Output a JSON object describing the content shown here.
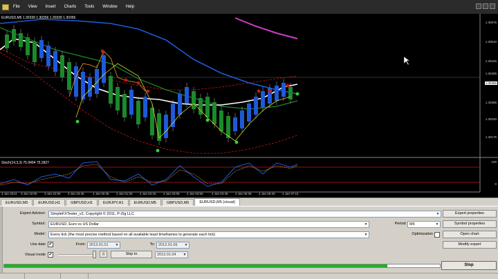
{
  "menu": {
    "items": [
      "File",
      "View",
      "Insert",
      "Charts",
      "Tools",
      "Window",
      "Help"
    ]
  },
  "chart": {
    "symbol_label": "EURUSD,M5 1.30339 1.30356 1.30339 1.30356",
    "osc_label": "Stoch(14,3,3) 75.9494 75.2827",
    "price_ticks": [
      "1.30575",
      "1.30510",
      "1.30445",
      "1.30405",
      "1.30356",
      "1.30285",
      "1.30220",
      "1.30175"
    ],
    "current_price": "1.30356",
    "osc_ticks": [
      "100",
      "0"
    ],
    "time_ticks": [
      "3 Jan 2013",
      "3 Jan 22:05",
      "3 Jan 22:55",
      "3 Jan 23:45",
      "4 Jan 00:35",
      "4 Jan 01:25",
      "4 Jan 02:15",
      "4 Jan 03:05",
      "4 Jan 03:55",
      "4 Jan 04:45",
      "4 Jan 05:35",
      "4 Jan 06:25",
      "4 Jan 07:15"
    ],
    "colors": {
      "green": "#1a8a2a",
      "blue": "#1e5ad8",
      "white": "#ffffff",
      "magenta": "#cc3dc6",
      "red": "#c41818",
      "orange": "#f0a020",
      "yellow": "#d7d73a"
    }
  },
  "tabs": {
    "items": [
      "EURUSD,M5",
      "EURUSD,H1",
      "GBPUSD,H1",
      "EURJPY,H1",
      "EURUSD,M5",
      "GBPUSD,M5",
      "EURUSD,M5 (visual)"
    ],
    "active_index": 6
  },
  "tester": {
    "expert_label": "Expert Advisor:",
    "expert_value": "SimpleFXTester_v2, Copyright © 2011, P-Zig LLC",
    "symbol_label": "Symbol:",
    "symbol_value": "EURUSD, Euro vs US Dollar",
    "period_label": "Period:",
    "period_value": "M5",
    "model_label": "Model:",
    "model_value": "Every tick (the most precise method based on all available least timeframes to generate each tick)",
    "optimization_label": "Optimization",
    "use_date_label": "Use date",
    "from_label": "From:",
    "from_value": "2013.01.01",
    "to_label": "To:",
    "to_value": "2013.01.06",
    "visual_mode_label": "Visual mode",
    "skip_to_label": "Skip to",
    "skip_to_value": "2013.01.04",
    "progress": 0.88,
    "buttons": {
      "expert_properties": "Expert properties",
      "symbol_properties": "Symbol properties",
      "open_chart": "Open chart",
      "modify_expert": "Modify expert",
      "stop": "Stop"
    },
    "pause_symbol": "||"
  }
}
